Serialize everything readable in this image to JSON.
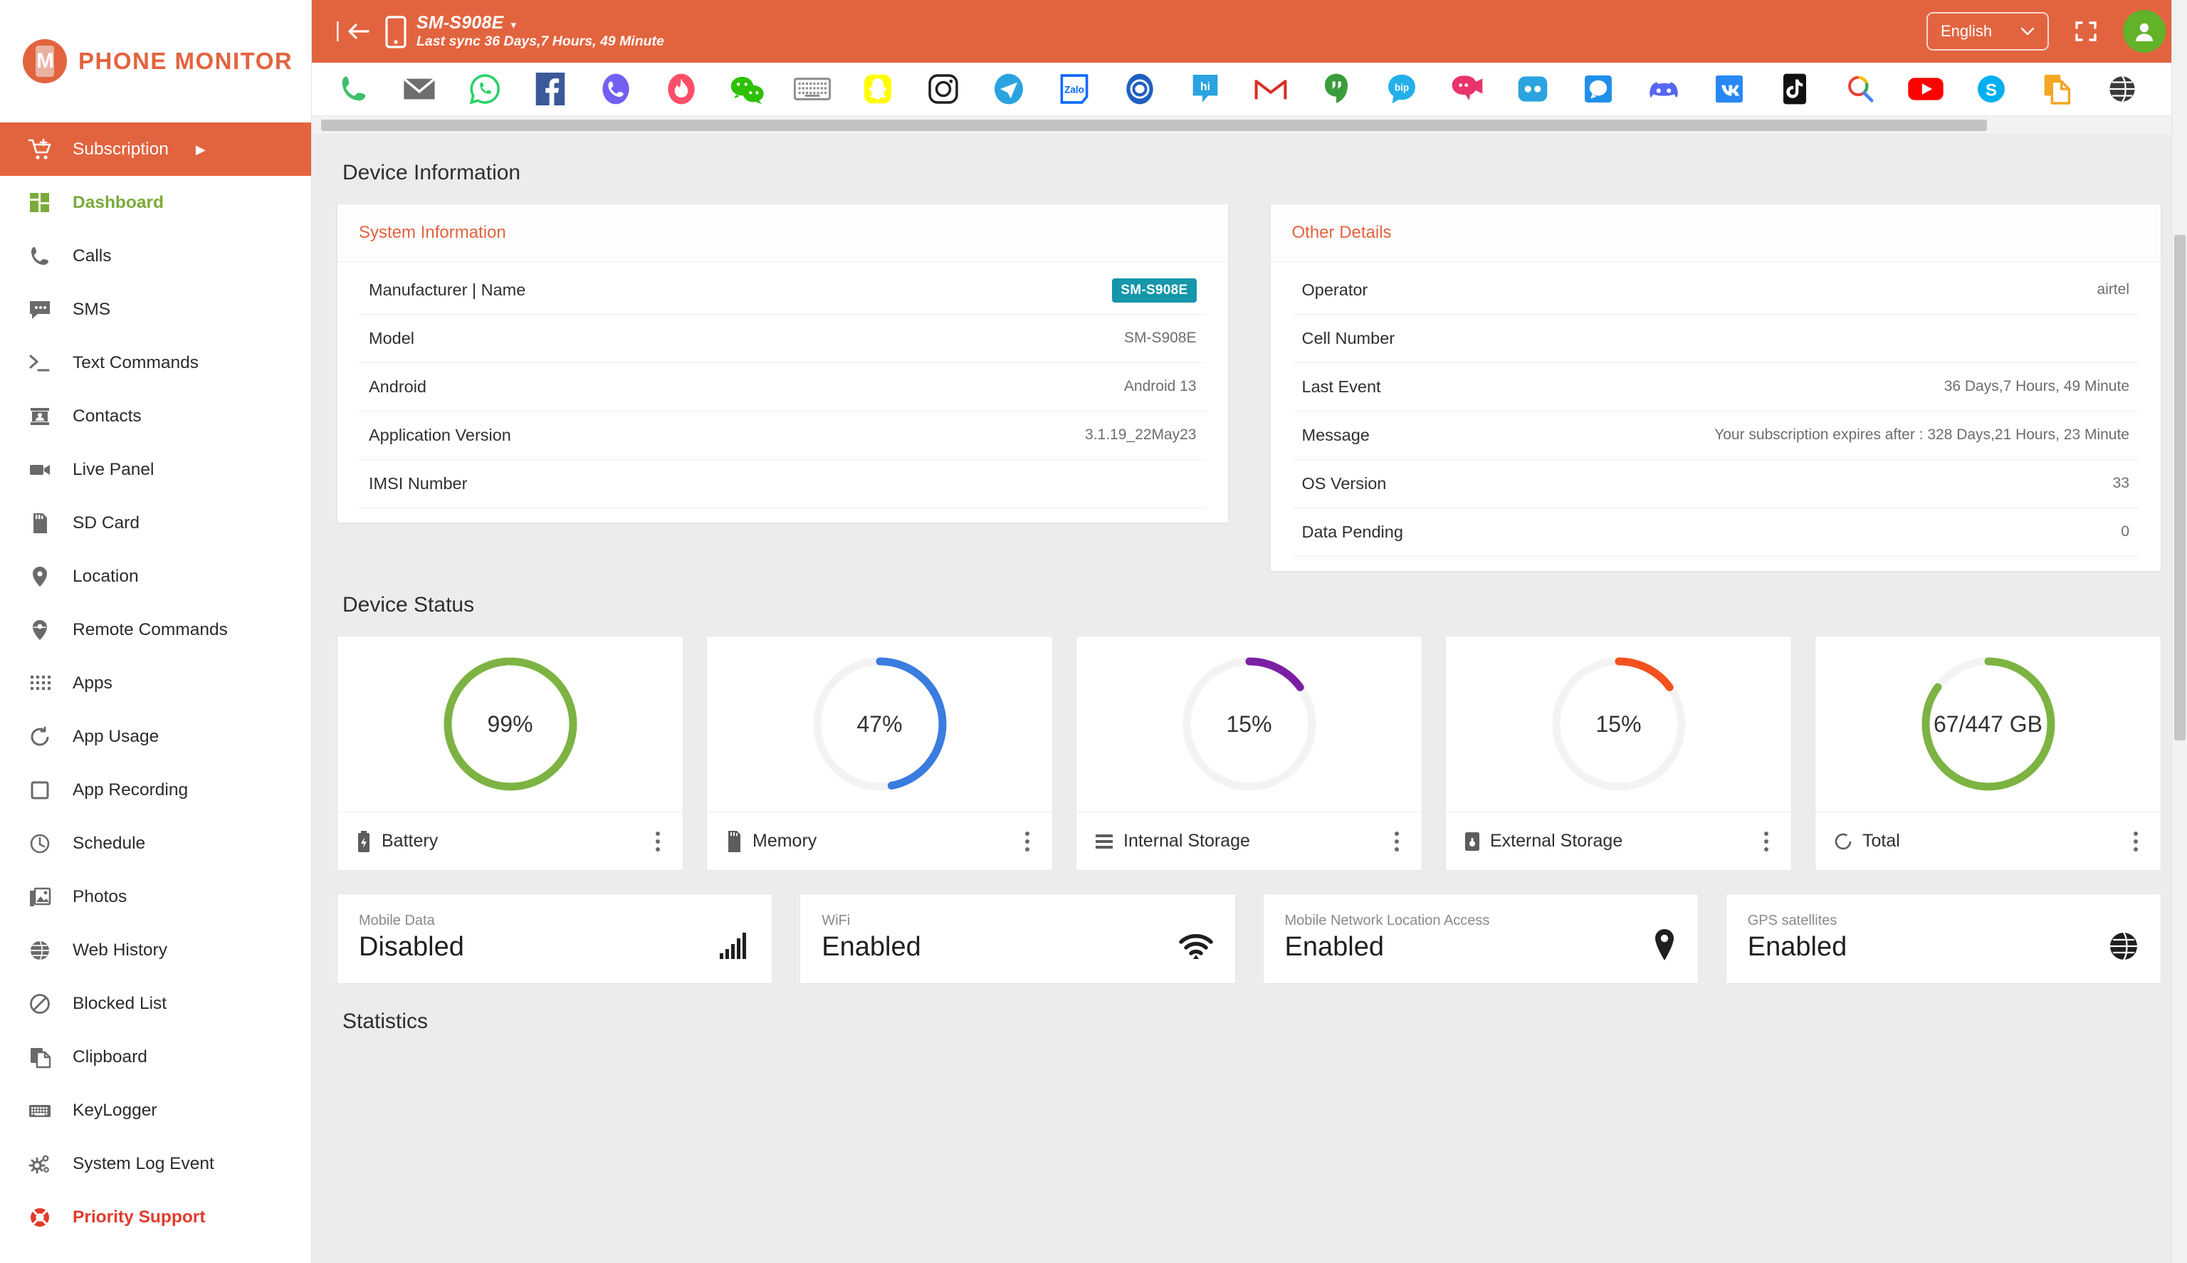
{
  "brand": {
    "name": "PHONE MONITOR",
    "mark_letter": "M"
  },
  "sidebar": {
    "items": [
      {
        "label": "Subscription",
        "icon": "cart-plus-icon",
        "state": "active",
        "caret": "▶"
      },
      {
        "label": "Dashboard",
        "icon": "dashboard-grid-icon",
        "state": "dashboard"
      },
      {
        "label": "Calls",
        "icon": "phone-icon",
        "state": ""
      },
      {
        "label": "SMS",
        "icon": "chat-bubble-icon",
        "state": ""
      },
      {
        "label": "Text Commands",
        "icon": "terminal-icon",
        "state": ""
      },
      {
        "label": "Contacts",
        "icon": "contact-card-icon",
        "state": ""
      },
      {
        "label": "Live Panel",
        "icon": "video-camera-icon",
        "state": ""
      },
      {
        "label": "SD Card",
        "icon": "sd-card-icon",
        "state": ""
      },
      {
        "label": "Location",
        "icon": "map-pin-icon",
        "state": ""
      },
      {
        "label": "Remote Commands",
        "icon": "remote-pin-icon",
        "state": ""
      },
      {
        "label": "Apps",
        "icon": "grid-dots-icon",
        "state": ""
      },
      {
        "label": "App Usage",
        "icon": "circle-usage-icon",
        "state": ""
      },
      {
        "label": "App Recording",
        "icon": "square-record-icon",
        "state": ""
      },
      {
        "label": "Schedule",
        "icon": "clock-icon",
        "state": ""
      },
      {
        "label": "Photos",
        "icon": "photos-icon",
        "state": ""
      },
      {
        "label": "Web History",
        "icon": "globe-icon",
        "state": ""
      },
      {
        "label": "Blocked List",
        "icon": "block-icon",
        "state": ""
      },
      {
        "label": "Clipboard",
        "icon": "clipboard-copy-icon",
        "state": ""
      },
      {
        "label": "KeyLogger",
        "icon": "keyboard-icon",
        "state": ""
      },
      {
        "label": "System Log Event",
        "icon": "gears-icon",
        "state": ""
      },
      {
        "label": "Priority Support",
        "icon": "lifebuoy-icon",
        "state": "support"
      }
    ]
  },
  "topbar": {
    "collapse_icon": "collapse-sidebar-icon",
    "device_name": "SM-S908E",
    "device_caret": "▾",
    "last_sync": "Last sync 36 Days,7 Hours, 49 Minute",
    "language": "English",
    "language_caret": "⌄",
    "fullscreen_icon": "fullscreen-icon",
    "avatar_icon": "user-avatar-icon"
  },
  "app_strip": {
    "apps": [
      {
        "name": "phone-app-icon",
        "color": "#3fc06a"
      },
      {
        "name": "email-app-icon",
        "color": "#6e6e6e"
      },
      {
        "name": "whatsapp-app-icon",
        "color": "#25d366"
      },
      {
        "name": "facebook-app-icon",
        "color": "#3b5998"
      },
      {
        "name": "viber-app-icon",
        "color": "#7360f2"
      },
      {
        "name": "tinder-app-icon",
        "color": "#fd5068"
      },
      {
        "name": "wechat-app-icon",
        "color": "#2dc100"
      },
      {
        "name": "keyboard-app-icon",
        "color": "#8e8e8e"
      },
      {
        "name": "snapchat-app-icon",
        "color": "#fffc00"
      },
      {
        "name": "instagram-app-icon",
        "color": "#222222"
      },
      {
        "name": "telegram-app-icon",
        "color": "#2aa3e0"
      },
      {
        "name": "zalo-app-icon",
        "color": "#0068ff"
      },
      {
        "name": "imo-app-icon",
        "color": "#1f5fbf"
      },
      {
        "name": "hike-app-icon",
        "color": "#2aa3e0"
      },
      {
        "name": "gmail-app-icon",
        "color": "#d93025"
      },
      {
        "name": "hangouts-app-icon",
        "color": "#3a9c3a"
      },
      {
        "name": "bip-app-icon",
        "color": "#23b0e8"
      },
      {
        "name": "camfrog-app-icon",
        "color": "#e8336d"
      },
      {
        "name": "odnoklassniki-app-icon",
        "color": "#2aa3e0"
      },
      {
        "name": "signal-app-icon",
        "color": "#2090ea"
      },
      {
        "name": "discord-app-icon",
        "color": "#5865f2"
      },
      {
        "name": "vk-app-icon",
        "color": "#2787f5"
      },
      {
        "name": "tiktok-app-icon",
        "color": "#111111"
      },
      {
        "name": "google-search-app-icon",
        "color": "#4285f4"
      },
      {
        "name": "youtube-app-icon",
        "color": "#ff0000"
      },
      {
        "name": "skype-app-icon",
        "color": "#00aff0"
      },
      {
        "name": "file-copy-app-icon",
        "color": "#f5a623"
      },
      {
        "name": "browser-app-icon",
        "color": "#3a3a3a"
      }
    ]
  },
  "device_information": {
    "heading": "Device Information",
    "system_information": {
      "title": "System Information",
      "rows": [
        {
          "key": "Manufacturer | Name",
          "value": "SM-S908E",
          "badge": true
        },
        {
          "key": "Model",
          "value": "SM-S908E",
          "badge": false
        },
        {
          "key": "Android",
          "value": "Android 13",
          "badge": false
        },
        {
          "key": "Application Version",
          "value": "3.1.19_22May23",
          "badge": false
        },
        {
          "key": "IMSI Number",
          "value": "",
          "badge": false
        }
      ]
    },
    "other_details": {
      "title": "Other Details",
      "rows": [
        {
          "key": "Operator",
          "value": "airtel"
        },
        {
          "key": "Cell Number",
          "value": ""
        },
        {
          "key": "Last Event",
          "value": "36 Days,7 Hours, 49 Minute"
        },
        {
          "key": "Message",
          "value": "Your subscription expires after : 328 Days,21 Hours, 23 Minute"
        },
        {
          "key": "OS Version",
          "value": "33"
        },
        {
          "key": "Data Pending",
          "value": "0"
        }
      ]
    }
  },
  "device_status": {
    "heading": "Device Status",
    "cards": [
      {
        "label": "Battery",
        "display": "99%",
        "percent": 99,
        "color": "#7cb342",
        "icon": "battery-icon"
      },
      {
        "label": "Memory",
        "display": "47%",
        "percent": 47,
        "color": "#3a7ce0",
        "icon": "memory-chip-icon"
      },
      {
        "label": "Internal Storage",
        "display": "15%",
        "percent": 15,
        "color": "#7b1fa2",
        "icon": "internal-storage-icon"
      },
      {
        "label": "External Storage",
        "display": "15%",
        "percent": 15,
        "color": "#f4511e",
        "icon": "external-storage-icon"
      },
      {
        "label": "Total",
        "display": "67/447 GB",
        "percent": 85,
        "color": "#7cb342",
        "icon": "total-circle-icon"
      }
    ],
    "toggles": [
      {
        "caption": "Mobile Data",
        "value": "Disabled",
        "icon": "signal-bars-icon"
      },
      {
        "caption": "WiFi",
        "value": "Enabled",
        "icon": "wifi-icon"
      },
      {
        "caption": "Mobile Network Location Access",
        "value": "Enabled",
        "icon": "map-pin-icon"
      },
      {
        "caption": "GPS satellites",
        "value": "Enabled",
        "icon": "globe-icon"
      }
    ]
  },
  "statistics": {
    "heading": "Statistics"
  },
  "colors": {
    "brand_orange": "#e2643f",
    "accent_green": "#7cb342",
    "badge_teal": "#1596aa",
    "support_red": "#e23b2e",
    "page_bg": "#ececec"
  }
}
